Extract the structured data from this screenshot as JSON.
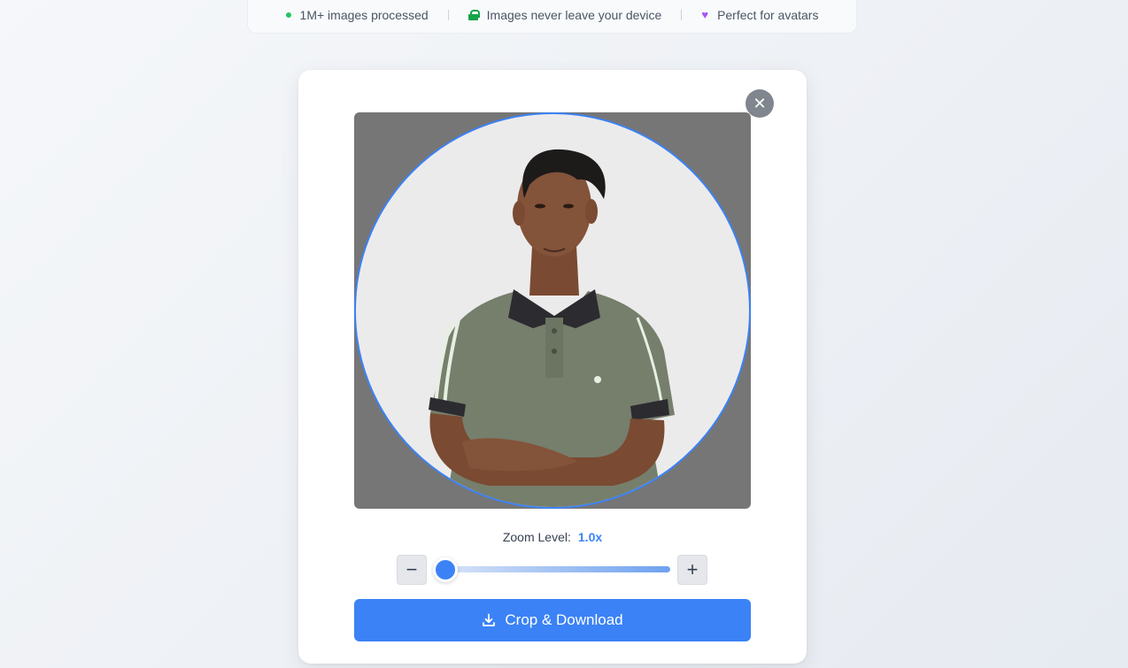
{
  "features": [
    {
      "icon": "green-dot-icon",
      "label": "1M+ images processed"
    },
    {
      "icon": "lock-icon",
      "label": "Images never leave your device"
    },
    {
      "icon": "heart-icon",
      "label": "Perfect for avatars"
    }
  ],
  "modal": {
    "close_symbol": "✕",
    "zoom_label": "Zoom Level:",
    "zoom_value": "1.0x",
    "zoom_out_symbol": "−",
    "zoom_in_symbol": "+",
    "slider_value": 0,
    "download_label": "Crop & Download"
  },
  "colors": {
    "accent": "#3b82f6",
    "crop_background": "#767676",
    "lock": "#16a34a",
    "dot": "#22c55e",
    "heart": "#a855f7"
  }
}
